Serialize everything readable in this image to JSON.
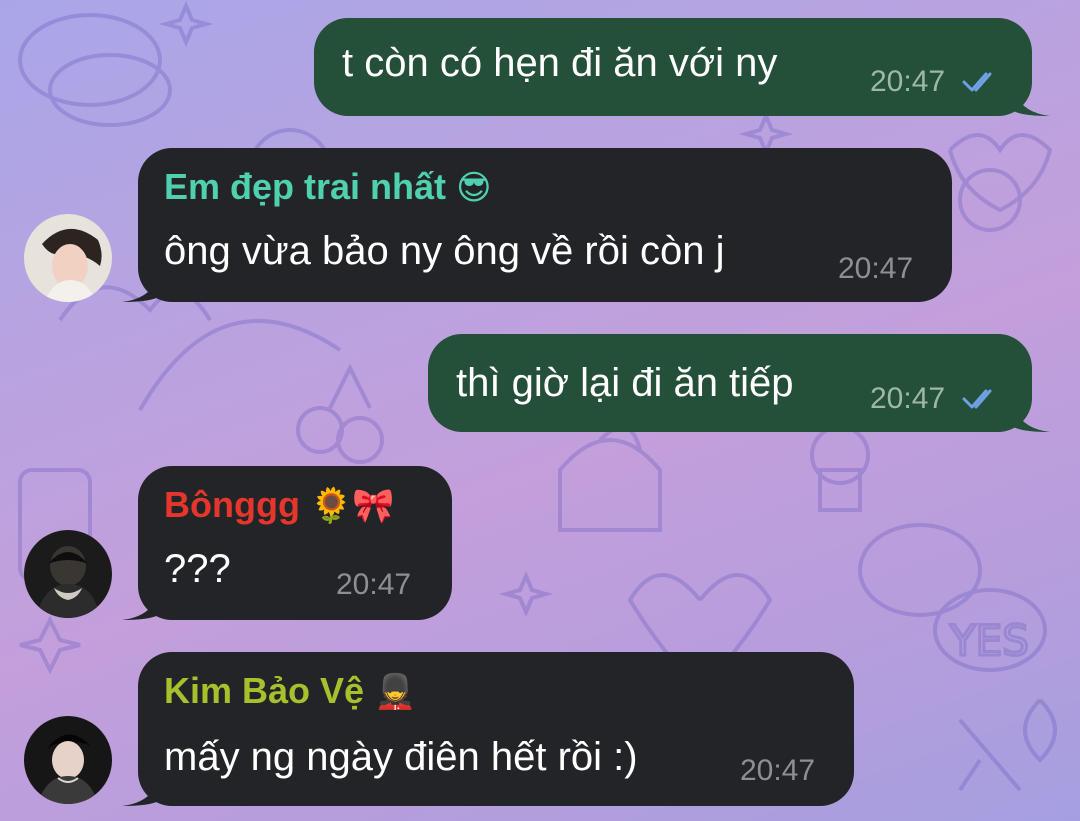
{
  "colors": {
    "outgoing_bubble": "#244f38",
    "incoming_bubble": "#232427",
    "read_ticks": "#6fa0e6",
    "sender_em": "#4fd1b0",
    "sender_bong": "#e5362b",
    "sender_kim": "#a6c12c"
  },
  "messages": [
    {
      "direction": "outgoing",
      "text": "t còn có hẹn đi ăn với ny",
      "time": "20:47",
      "status_icon": "double-check-read-icon"
    },
    {
      "direction": "incoming",
      "sender": "Em đẹp trai nhất",
      "sender_emoji": "😎",
      "text": "ông vừa bảo ny ông về rồi còn j",
      "time": "20:47",
      "avatar_icon": "user-avatar-1"
    },
    {
      "direction": "outgoing",
      "text": "thì giờ lại đi ăn tiếp",
      "time": "20:47",
      "status_icon": "double-check-read-icon"
    },
    {
      "direction": "incoming",
      "sender": "Bônggg",
      "sender_emoji": "🌻🎀",
      "text": "???",
      "time": "20:47",
      "avatar_icon": "user-avatar-2"
    },
    {
      "direction": "incoming",
      "sender": "Kim Bảo Vệ",
      "sender_emoji": "💂",
      "text": "mấy ng ngày điên hết rồi :)",
      "time": "20:47",
      "avatar_icon": "user-avatar-3"
    }
  ]
}
